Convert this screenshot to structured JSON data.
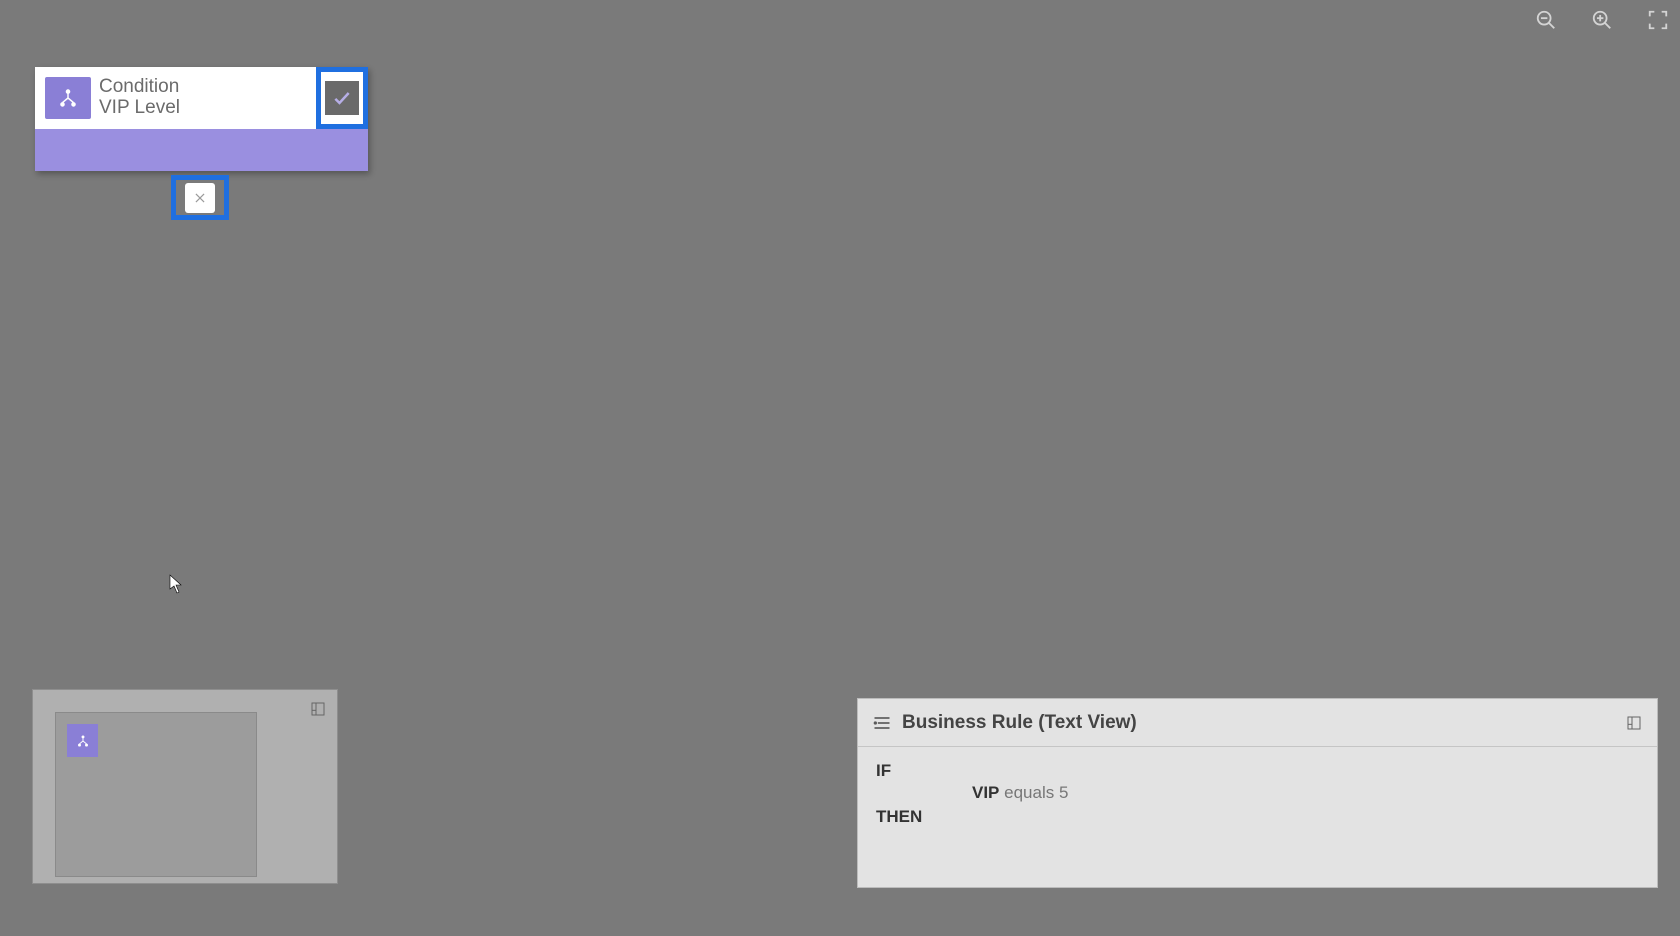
{
  "toolbar": {
    "zoom_out_name": "zoom-out",
    "zoom_in_name": "zoom-in",
    "fullscreen_name": "fullscreen"
  },
  "condition_node": {
    "title": "Condition",
    "subtitle": "VIP Level"
  },
  "minimap": {},
  "text_view": {
    "title": "Business Rule (Text View)",
    "if_label": "IF",
    "then_label": "THEN",
    "condition": {
      "field": "VIP",
      "operator": "equals",
      "value": "5"
    }
  }
}
